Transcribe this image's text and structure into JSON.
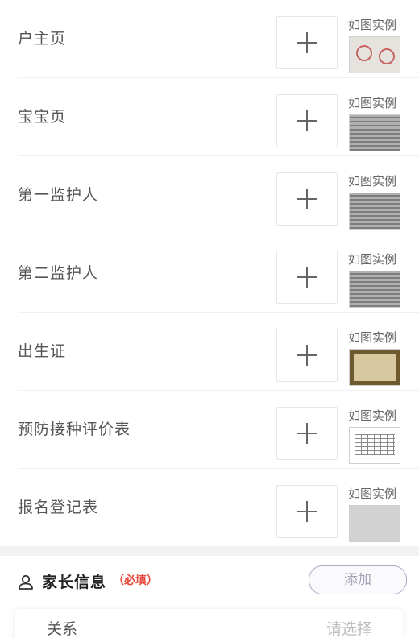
{
  "example_label": "如图实例",
  "upload_rows": [
    {
      "label": "户主页",
      "thumb": "seal-document"
    },
    {
      "label": "宝宝页",
      "thumb": "gray-document"
    },
    {
      "label": "第一监护人",
      "thumb": "gray-document"
    },
    {
      "label": "第二监护人",
      "thumb": "gray-document"
    },
    {
      "label": "出生证",
      "thumb": "birth-certificate"
    },
    {
      "label": "预防接种评价表",
      "thumb": "table-document"
    },
    {
      "label": "报名登记表",
      "thumb": "handwritten-form"
    }
  ],
  "parent_section": {
    "title": "家长信息",
    "required": "（必填）",
    "add_label": "添加",
    "relation_label": "关系",
    "relation_placeholder": "请选择"
  },
  "colors": {
    "required": "#e94b3c",
    "add_button_border": "#a9a9c8",
    "divider": "#f2f2f2"
  }
}
